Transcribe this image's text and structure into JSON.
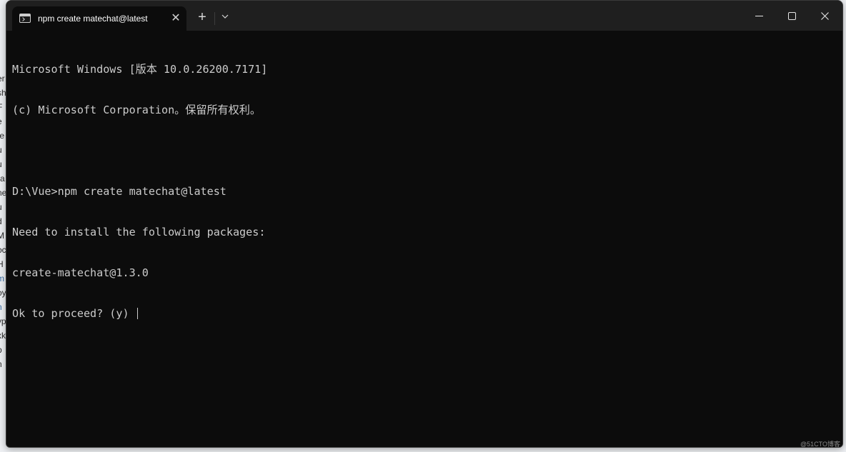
{
  "tab": {
    "title": "npm create matechat@latest",
    "close_glyph": "✕",
    "icon": "terminal-icon"
  },
  "titlebar": {
    "new_tab_glyph": "+",
    "dropdown_icon": "chevron-down-icon",
    "minimize_icon": "minimize-icon",
    "maximize_icon": "maximize-icon",
    "close_icon": "close-icon"
  },
  "terminal": {
    "lines": [
      "Microsoft Windows [版本 10.0.26200.7171]",
      "(c) Microsoft Corporation。保留所有权利。",
      "",
      "D:\\Vue>npm create matechat@latest",
      "Need to install the following packages:",
      "create-matechat@1.3.0",
      "Ok to proceed? (y) "
    ]
  },
  "watermark": "@51CTO博客",
  "background_strip": [
    "er",
    "sh",
    "F",
    "e",
    "",
    "te",
    "u",
    "u",
    "ra",
    "ne",
    "u",
    "d",
    "M",
    "oc",
    "H",
    "m",
    "oy",
    "n",
    "ур",
    "xk",
    "p",
    "n"
  ],
  "colors": {
    "terminal_bg": "#0c0c0c",
    "titlebar_bg": "#1f1f1f",
    "text": "#cccccc"
  }
}
